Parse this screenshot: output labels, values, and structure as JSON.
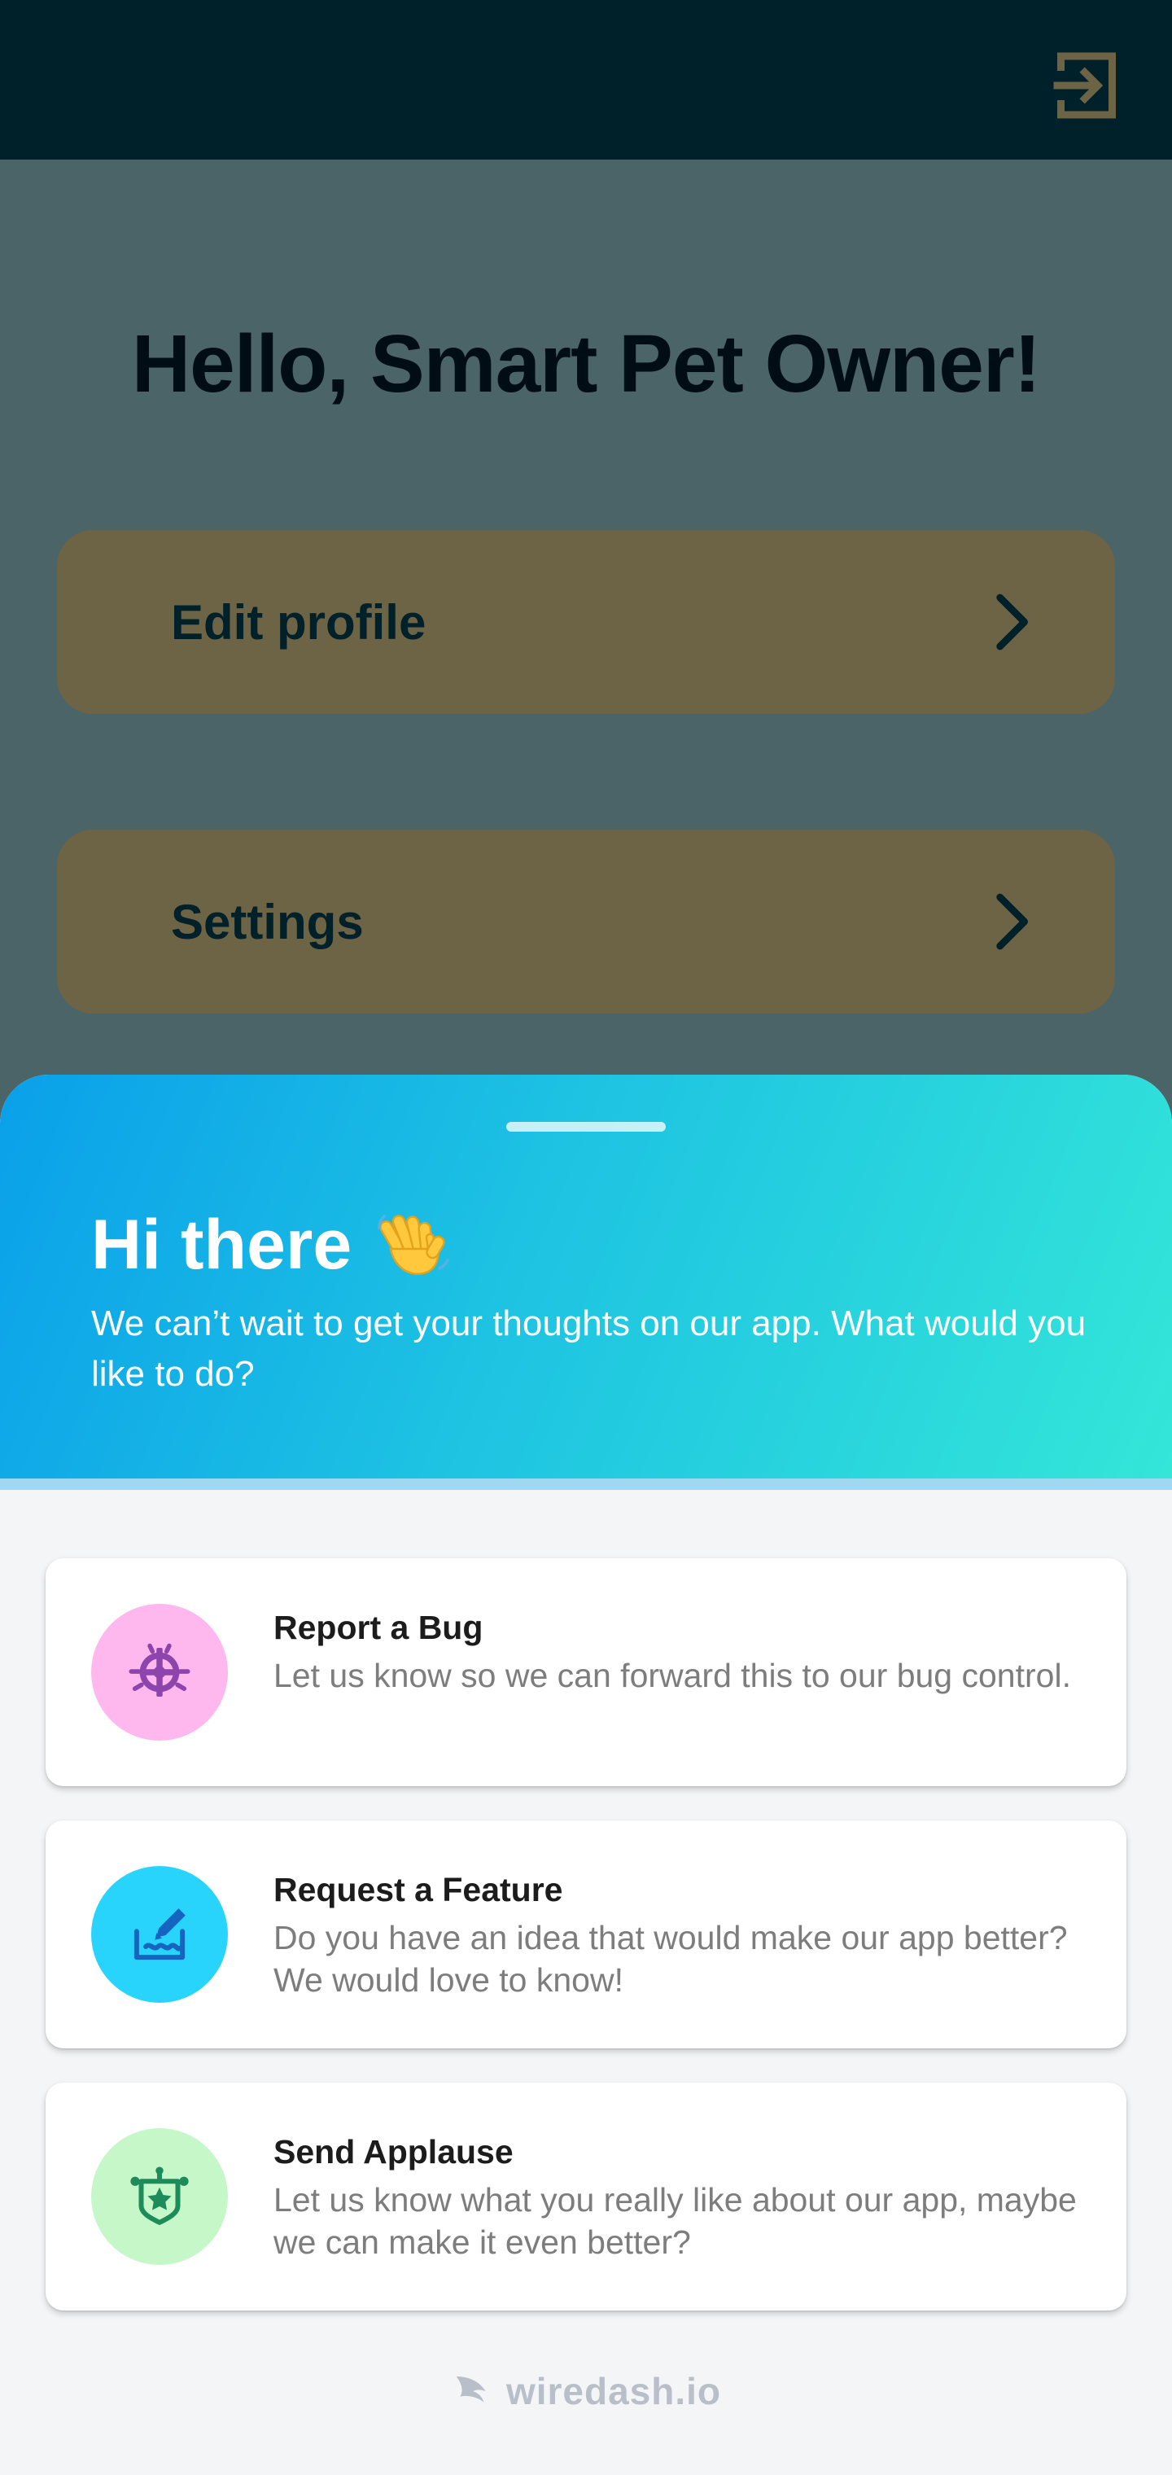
{
  "appbar": {
    "logout_icon": "logout-icon",
    "color": "#00202a",
    "accent": "#6d6345"
  },
  "home": {
    "greeting": "Hello, Smart Pet Owner!",
    "menu": [
      {
        "label": "Edit profile",
        "icon": "chevron-right-icon"
      },
      {
        "label": "Settings",
        "icon": "chevron-right-icon"
      }
    ]
  },
  "feedback_sheet": {
    "title": "Hi there",
    "title_emoji": "waving-hand-icon",
    "subtitle": "We can’t wait to get your thoughts on our app. What would you like to do?",
    "options": [
      {
        "title": "Report a Bug",
        "description": "Let us know so we can forward this to our bug control.",
        "icon": "bug-icon",
        "color": "#ffb8ee"
      },
      {
        "title": "Request a Feature",
        "description": "Do you have an idea that would make our app better? We would love to know!",
        "icon": "feature-request-icon",
        "color": "#29d4fc"
      },
      {
        "title": "Send Applause",
        "description": "Let us know what you really like about our app, maybe we can make it even better?",
        "icon": "applause-icon",
        "color": "#c6f7c8"
      }
    ],
    "branding": "wiredash.io"
  }
}
